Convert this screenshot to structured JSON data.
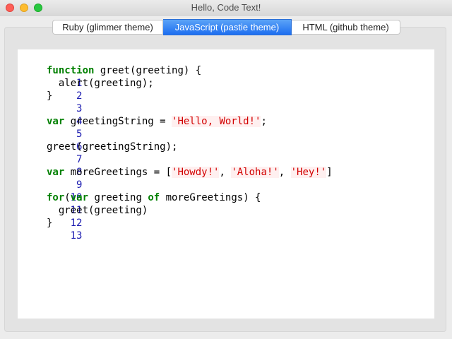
{
  "window": {
    "title": "Hello, Code Text!"
  },
  "tabs": [
    {
      "label": "Ruby (glimmer theme)",
      "selected": false
    },
    {
      "label": "JavaScript (pastie theme)",
      "selected": true
    },
    {
      "label": "HTML (github theme)",
      "selected": false
    }
  ],
  "colors": {
    "keyword": "#008000",
    "string": "#d20000",
    "string_bg": "#fff0f0",
    "line_number": "#1b1bb0",
    "tab_active": "#1d6ef0"
  },
  "code": {
    "line_numbers": [
      "1",
      "2",
      "3",
      "4",
      "5",
      "6",
      "7",
      "8",
      "9",
      "10",
      "11",
      "12",
      "13"
    ],
    "l1": {
      "kw": "function",
      "rest": " greet(greeting) {"
    },
    "l2": {
      "text": "  alert(greeting);"
    },
    "l3": {
      "text": "}"
    },
    "l5": {
      "kw": "var",
      "mid": " greetingString = ",
      "str": "'Hello, World!'",
      "end": ";"
    },
    "l7": {
      "text": "greet(greetingString);"
    },
    "l9": {
      "kw": "var",
      "mid": " moreGreetings = [",
      "s1": "'Howdy!'",
      "c1": ", ",
      "s2": "'Aloha!'",
      "c2": ", ",
      "s3": "'Hey!'",
      "end": "]"
    },
    "l11": {
      "kw1": "for",
      "p1": "(",
      "kw2": "var",
      "mid": " greeting ",
      "kw3": "of",
      "end": " moreGreetings) {"
    },
    "l12": {
      "text": "  greet(greeting)"
    },
    "l13": {
      "text": "}"
    }
  }
}
